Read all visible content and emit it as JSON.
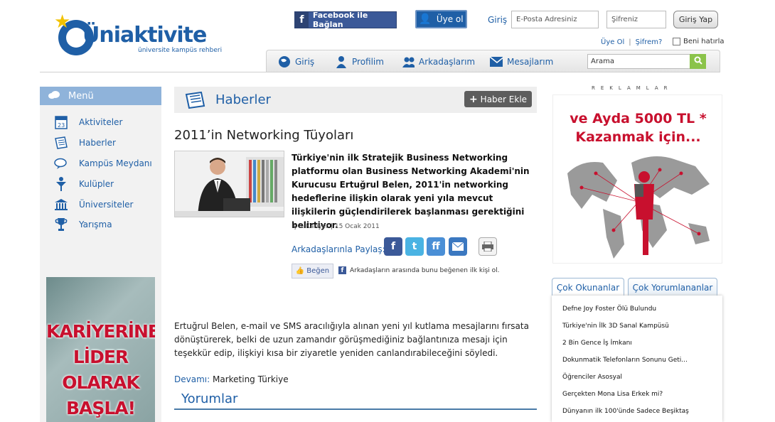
{
  "header": {
    "logo_text": "Üniaktivite",
    "logo_sub": "üniversite kampüs rehberi",
    "facebook_button": "Facebook ile Bağlan",
    "signup_button": "Üye ol",
    "login_label": "Giriş",
    "email_placeholder": "E-Posta Adresiniz",
    "password_placeholder": "Şifreniz",
    "login_button": "Giriş Yap",
    "register_link": "Üye Ol",
    "separator": "|",
    "forgot_link": "Şifrem?",
    "remember_label": "Beni hatırla"
  },
  "nav": {
    "items": [
      {
        "label": "Giriş",
        "icon": "globe-icon"
      },
      {
        "label": "Profilim",
        "icon": "person-icon"
      },
      {
        "label": "Arkadaşlarım",
        "icon": "friends-icon"
      },
      {
        "label": "Mesajlarım",
        "icon": "envelope-icon"
      }
    ],
    "search_value": "Arama"
  },
  "sidebar": {
    "title": "Menü",
    "items": [
      {
        "label": "Aktiviteler",
        "icon": "calendar-icon",
        "icon_text": "23"
      },
      {
        "label": "Haberler",
        "icon": "newspaper-icon"
      },
      {
        "label": "Kampüs Meydanı",
        "icon": "chat-icon"
      },
      {
        "label": "Kulüpler",
        "icon": "club-icon"
      },
      {
        "label": "Üniversiteler",
        "icon": "university-icon"
      },
      {
        "label": "Yarışma",
        "icon": "trophy-icon"
      }
    ],
    "ad": {
      "line1": "KARİYERİNE",
      "line2": "LİDER",
      "line3": "OLARAK",
      "line4": "BAŞLA!"
    }
  },
  "main": {
    "section_title": "Haberler",
    "add_button": "Haber Ekle",
    "article": {
      "title": "2011’in Networking Tüyoları",
      "lead": "Türkiye'nin ilk Stratejik Business Networking platformu olan Business Networking Akademi'nin Kurucusu Ertuğrul Belen, 2011'in networking hedeflerine ilişkin olarak yeni yıla mevcut ilişkilerin güçlendirilerek başlanması gerektiğini belirtiyor.",
      "meta": "İş & Kariyer | 15 Ocak 2011",
      "share_label": "Arkadaşlarınla Paylaş:",
      "like_button": "Beğen",
      "like_text": "Arkadaşların arasında bunu beğenen ilk kişi ol.",
      "body": "Ertuğrul Belen, e-mail ve SMS aracılığıyla alınan yeni yıl kutlama mesajlarını fırsata dönüştürerek, belki de uzun zamandır görüşmediğiniz bağlantınıza mesajı için teşekkür edip, ilişkiyi kısa bir ziyaretle yeniden canlandırabileceğini söyledi.",
      "source_label": "Devamı:",
      "source_value": "Marketing Türkiye"
    },
    "comments_title": "Yorumlar"
  },
  "right": {
    "ads_label": "REKLAMLAR",
    "ad_line1": "ve Ayda 5000 TL *",
    "ad_line2": "Kazanmak için...",
    "tabs": [
      "Çok Okunanlar",
      "Çok Yorumlananlar"
    ],
    "list": [
      "Defne Joy Foster Ölü Bulundu",
      "Türkiye'nin İlk 3D Sanal Kampüsü",
      "2 Bin Gence İş İmkanı",
      "Dokunmatik Telefonların Sonunu Geti...",
      "Öğrenciler Asosyal",
      "Gerçekten Mona Lisa Erkek mi?",
      "Dünyanın ilk 100'ünde Sadece Beşiktaş"
    ]
  }
}
